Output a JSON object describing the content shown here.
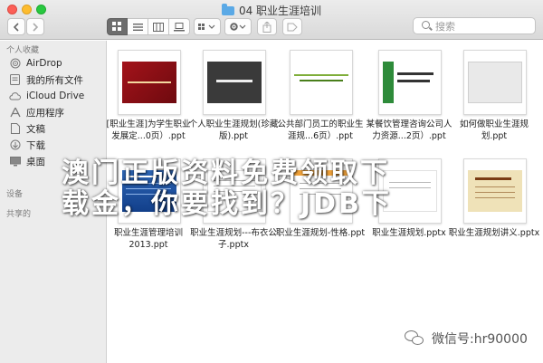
{
  "window": {
    "title": "04 职业生涯培训"
  },
  "toolbar": {
    "back_icon": "chevron-left-icon",
    "forward_icon": "chevron-right-icon",
    "search_placeholder": "搜索"
  },
  "sidebar": {
    "favorites_header": "个人收藏",
    "items": [
      {
        "label": "AirDrop",
        "icon": "airdrop-icon"
      },
      {
        "label": "我的所有文件",
        "icon": "all-files-icon"
      },
      {
        "label": "iCloud Drive",
        "icon": "cloud-icon"
      },
      {
        "label": "应用程序",
        "icon": "applications-icon"
      },
      {
        "label": "文稿",
        "icon": "documents-icon"
      },
      {
        "label": "下载",
        "icon": "download-icon"
      },
      {
        "label": "桌面",
        "icon": "desktop-icon"
      }
    ],
    "devices_header": "设备",
    "shared_header": "共享的"
  },
  "files": [
    {
      "name": "[职业生涯]为学生职业发展定...0页）.ppt"
    },
    {
      "name": "个人职业生涯规划(珍藏版).ppt"
    },
    {
      "name": "公共部门员工的职业生涯规...6页）.ppt"
    },
    {
      "name": "某餐饮管理咨询公司人力资源...2页）.ppt"
    },
    {
      "name": "如何做职业生涯规划.ppt"
    },
    {
      "name": "职业生涯管理培训2013.ppt"
    },
    {
      "name": "职业生涯规划---布衣公子.pptx"
    },
    {
      "name": "职业生涯规划-性格.ppt"
    },
    {
      "name": "职业生涯规划.pptx"
    },
    {
      "name": "职业生涯规划讲义.pptx"
    }
  ],
  "overlay": {
    "line1": "澳门正版资料免费领取下",
    "line2": "载金，你要找到？JDB下",
    "wechat": "微信号:hr90000"
  },
  "colors": {
    "accent_folder": "#5aa9e6",
    "close": "#fc5f57",
    "minimize": "#fdbc2e",
    "maximize": "#28c840"
  }
}
